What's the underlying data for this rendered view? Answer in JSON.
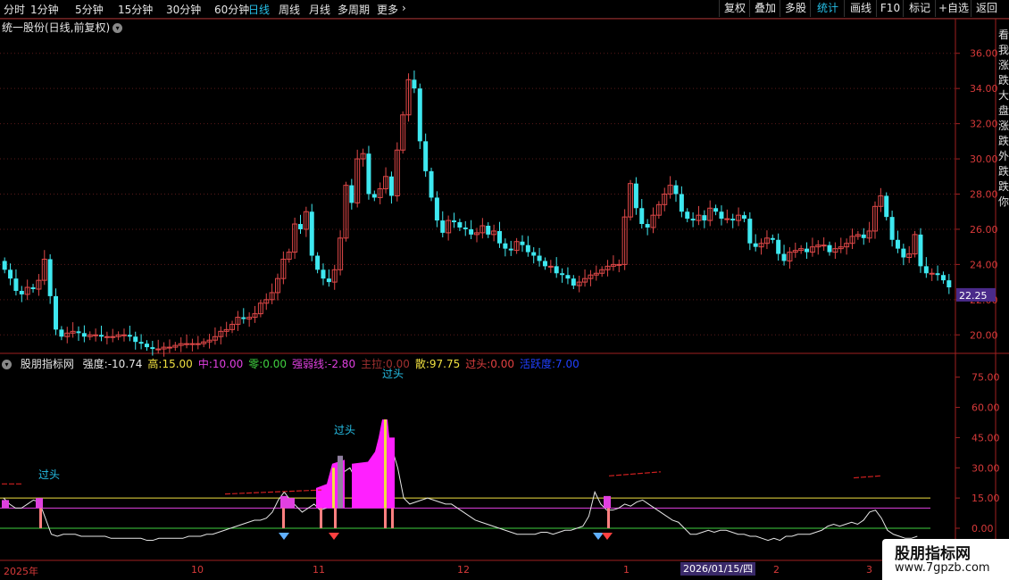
{
  "toolbar": {
    "periods": [
      "分时",
      "1分钟",
      "5分钟",
      "15分钟",
      "30分钟",
      "60分钟",
      "日线",
      "周线",
      "月线",
      "多周期",
      "更多"
    ],
    "active_period": "日线",
    "right_buttons": [
      "复权",
      "叠加",
      "多股",
      "统计",
      "画线",
      "F10",
      "标记",
      "+自选",
      "返回"
    ],
    "active_right": "统计"
  },
  "main": {
    "title": "统一股份(日线,前复权)",
    "price_axis": [
      "36.00",
      "34.00",
      "32.00",
      "30.00",
      "28.00",
      "26.00",
      "24.00",
      "22.00",
      "20.00"
    ],
    "current_price": "22.25"
  },
  "indicator": {
    "name": "股朋指标网",
    "fields": [
      {
        "label": "强度:",
        "value": "-10.74",
        "color": "#e6e6e6"
      },
      {
        "label": "高:",
        "value": "15.00",
        "color": "#f0e040"
      },
      {
        "label": "中:",
        "value": "10.00",
        "color": "#e040e0"
      },
      {
        "label": "零:",
        "value": "0.00",
        "color": "#40d040"
      },
      {
        "label": "强弱线:",
        "value": "-2.80",
        "color": "#e040e0"
      },
      {
        "label": "主拉:",
        "value": "0.00",
        "color": "#a03030"
      },
      {
        "label": "散:",
        "value": "97.75",
        "color": "#f0e040"
      },
      {
        "label": "过头:",
        "value": "0.00",
        "color": "#e04040"
      },
      {
        "label": "活跃度:",
        "value": "7.00",
        "color": "#2040ff"
      }
    ],
    "axis": [
      "75.00",
      "60.00",
      "45.00",
      "30.00",
      "15.00",
      "0.00"
    ],
    "annotations": [
      "过头",
      "过头",
      "过头"
    ]
  },
  "date_axis": [
    "2025年",
    "10",
    "11",
    "12",
    "1",
    "2",
    "3"
  ],
  "cursor_date": "2026/01/15/四",
  "watermark": {
    "name": "股朋指标网",
    "url": "www.7gpzb.com"
  },
  "side_text": [
    "看",
    "我",
    "涨",
    "跌",
    "大",
    "盘",
    "涨",
    "跌",
    "外",
    "跌",
    "跌",
    "你"
  ]
}
